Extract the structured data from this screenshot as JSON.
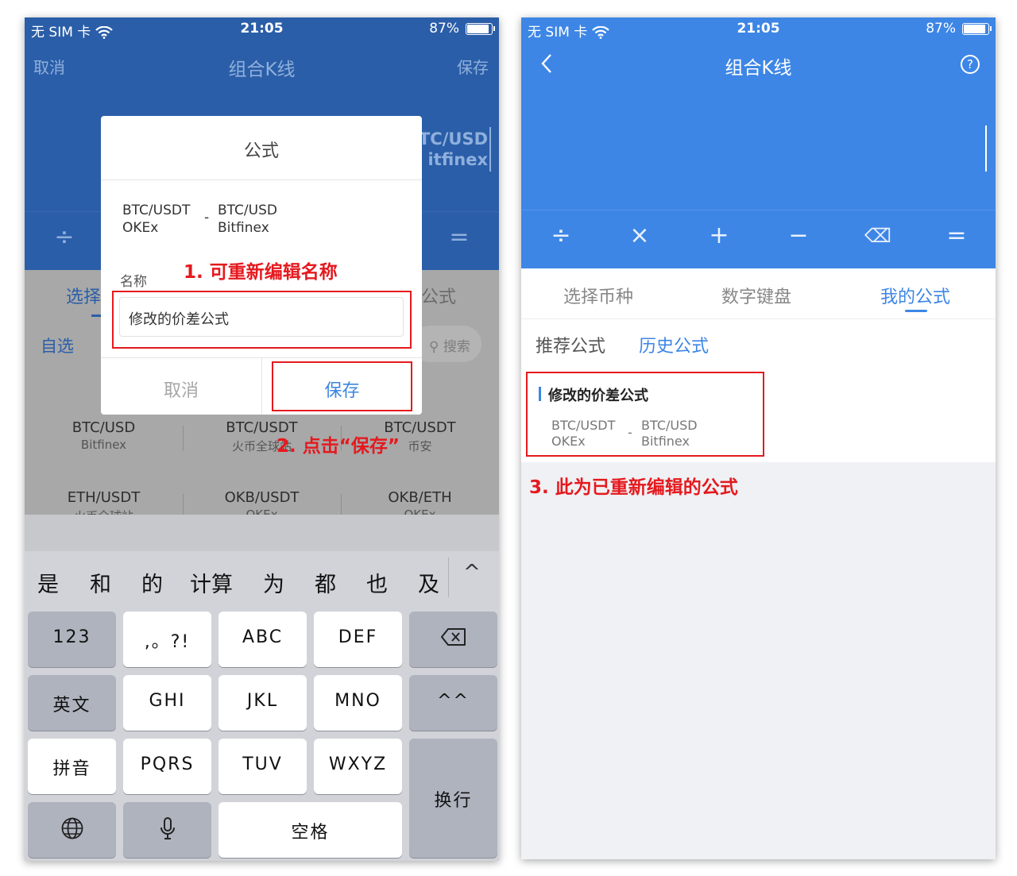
{
  "status": {
    "carrier": "无 SIM 卡",
    "time": "21:05",
    "battery": "87%"
  },
  "left": {
    "nav": {
      "cancel": "取消",
      "title": "组合K线",
      "save": "保存"
    },
    "peek": {
      "pair": "TC/USD",
      "exchange": "itfinex"
    },
    "ops": [
      "÷",
      "="
    ],
    "tabs": {
      "select": "选择",
      "formula": "公式"
    },
    "watchlist": "自选",
    "search": "搜索",
    "markets": [
      {
        "pair": "BTC/USD",
        "exchange": "Bitfinex"
      },
      {
        "pair": "BTC/USDT",
        "exchange": "火币全球站"
      },
      {
        "pair": "BTC/USDT",
        "exchange": "币安"
      },
      {
        "pair": "ETH/USDT",
        "exchange": "火币全球站"
      },
      {
        "pair": "OKB/USDT",
        "exchange": "OKEx"
      },
      {
        "pair": "OKB/ETH",
        "exchange": "OKEx"
      }
    ],
    "dialog": {
      "title": "公式",
      "a_pair": "BTC/USDT",
      "a_exchange": "OKEx",
      "op": "-",
      "b_pair": "BTC/USD",
      "b_exchange": "Bitfinex",
      "name_label": "名称",
      "name_value": "修改的价差公式",
      "cancel": "取消",
      "save": "保存"
    },
    "keyboard": {
      "candidates": [
        "是",
        "和",
        "的",
        "计算",
        "为",
        "都",
        "也",
        "及"
      ],
      "collapse": "^",
      "keys": {
        "k123": "123",
        "punct": ",。?!",
        "abc": "ABC",
        "def": "DEF",
        "en": "英文",
        "ghi": "GHI",
        "jkl": "JKL",
        "mno": "MNO",
        "emoji": "^^",
        "pinyin": "拼音",
        "pqrs": "PQRS",
        "tuv": "TUV",
        "wxyz": "WXYZ",
        "enter": "换行",
        "space": "空格"
      }
    }
  },
  "right": {
    "nav": {
      "title": "组合K线",
      "help": "?"
    },
    "ops": [
      "÷",
      "×",
      "+",
      "−",
      "⌫",
      "="
    ],
    "tabs": [
      "选择币种",
      "数字键盘",
      "我的公式"
    ],
    "subtabs": [
      "推荐公式",
      "历史公式"
    ],
    "card": {
      "title": "修改的价差公式",
      "a_pair": "BTC/USDT",
      "a_exchange": "OKEx",
      "op": "-",
      "b_pair": "BTC/USD",
      "b_exchange": "Bitfinex"
    }
  },
  "annotations": {
    "a1": "1. 可重新编辑名称",
    "a2": "2. 点击“保存”",
    "a3": "3. 此为已重新编辑的公式"
  },
  "colors": {
    "annotation": "#e5191e",
    "brand_blue": "#3d86e6"
  }
}
